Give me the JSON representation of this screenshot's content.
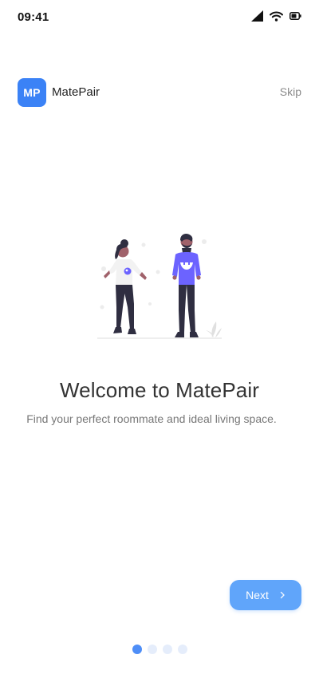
{
  "status_bar": {
    "time": "09:41",
    "icons": [
      "cellular-signal-icon",
      "wifi-icon",
      "battery-icon"
    ]
  },
  "header": {
    "logo_text": "MP",
    "app_name": "MatePair",
    "skip_label": "Skip"
  },
  "onboarding": {
    "illustration": "two-people-illustration",
    "title": "Welcome to MatePair",
    "subtitle": "Find your perfect roommate and ideal living space.",
    "next_label": "Next",
    "next_icon": "chevron-right-icon",
    "pages": 4,
    "current_page": 1
  },
  "colors": {
    "primary": "#3b82f6",
    "button": "#60a5fa",
    "dot_inactive": "#e5edfb",
    "character_shirt": "#6c63ff"
  }
}
